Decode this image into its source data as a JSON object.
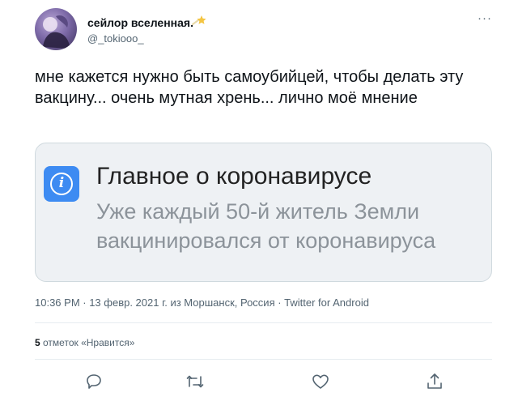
{
  "author": {
    "display_name": "сейлор вселенная.",
    "handle": "@_tokiooo_",
    "avatar_icon": "avatar-image",
    "badge_icon": "shooting-star-icon",
    "more_icon": "ellipsis-icon",
    "more_glyph": "···"
  },
  "tweet": {
    "text": "мне кажется нужно быть самоубийцей, чтобы делать эту вакцину... очень мутная хрень... лично моё мнение"
  },
  "card": {
    "icon": "info-icon",
    "icon_glyph": "i",
    "icon_color": "#3d8bf2",
    "title": "Главное о коронавирусе",
    "subtitle": "Уже каждый 50-й житель Земли вакцинировался от коронавируса"
  },
  "meta": {
    "timestamp": "10:36 PM · 13 февр. 2021 г. из Моршанск, Россия · Twitter for Android"
  },
  "likes": {
    "count": "5",
    "label": " отметок «Нравится»"
  },
  "actions": [
    {
      "name": "reply",
      "icon": "reply-icon"
    },
    {
      "name": "retweet",
      "icon": "retweet-icon"
    },
    {
      "name": "like",
      "icon": "heart-icon"
    },
    {
      "name": "share",
      "icon": "share-icon"
    }
  ],
  "colors": {
    "text": "#0f1419",
    "secondary": "#536471",
    "card_background": "#eef1f4",
    "action_icon": "#536471"
  }
}
